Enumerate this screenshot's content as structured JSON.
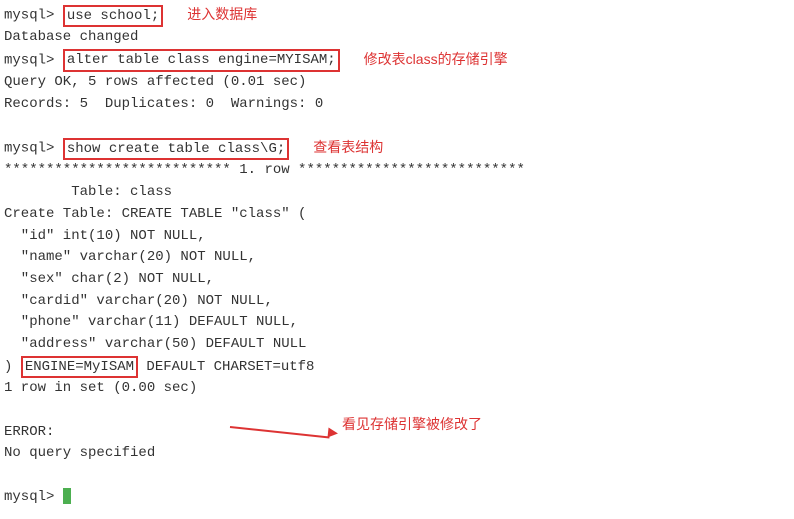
{
  "prompt": "mysql>",
  "cmd1": "use school;",
  "anno1": "进入数据库",
  "resp1": "Database changed",
  "cmd2": "alter table class engine=MYISAM;",
  "anno2": "修改表class的存储引擎",
  "resp2a": "Query OK, 5 rows affected (0.01 sec)",
  "resp2b": "Records: 5  Duplicates: 0  Warnings: 0",
  "cmd3": "show create table class\\G;",
  "anno3": "查看表结构",
  "row_sep": "*************************** 1. row ***************************",
  "table_line": "        Table: class",
  "create_header": "Create Table: CREATE TABLE \"class\" (",
  "col_id": "  \"id\" int(10) NOT NULL,",
  "col_name": "  \"name\" varchar(20) NOT NULL,",
  "col_sex": "  \"sex\" char(2) NOT NULL,",
  "col_cardid": "  \"cardid\" varchar(20) NOT NULL,",
  "col_phone": "  \"phone\" varchar(11) DEFAULT NULL,",
  "col_addr": "  \"address\" varchar(50) DEFAULT NULL",
  "close_paren": ") ",
  "engine_box": "ENGINE=MyISAM",
  "charset_tail": " DEFAULT CHARSET=utf8",
  "rows_in_set": "1 row in set (0.00 sec)",
  "anno4": "看见存储引擎被修改了",
  "error_label": "ERROR:",
  "error_msg": "No query specified"
}
